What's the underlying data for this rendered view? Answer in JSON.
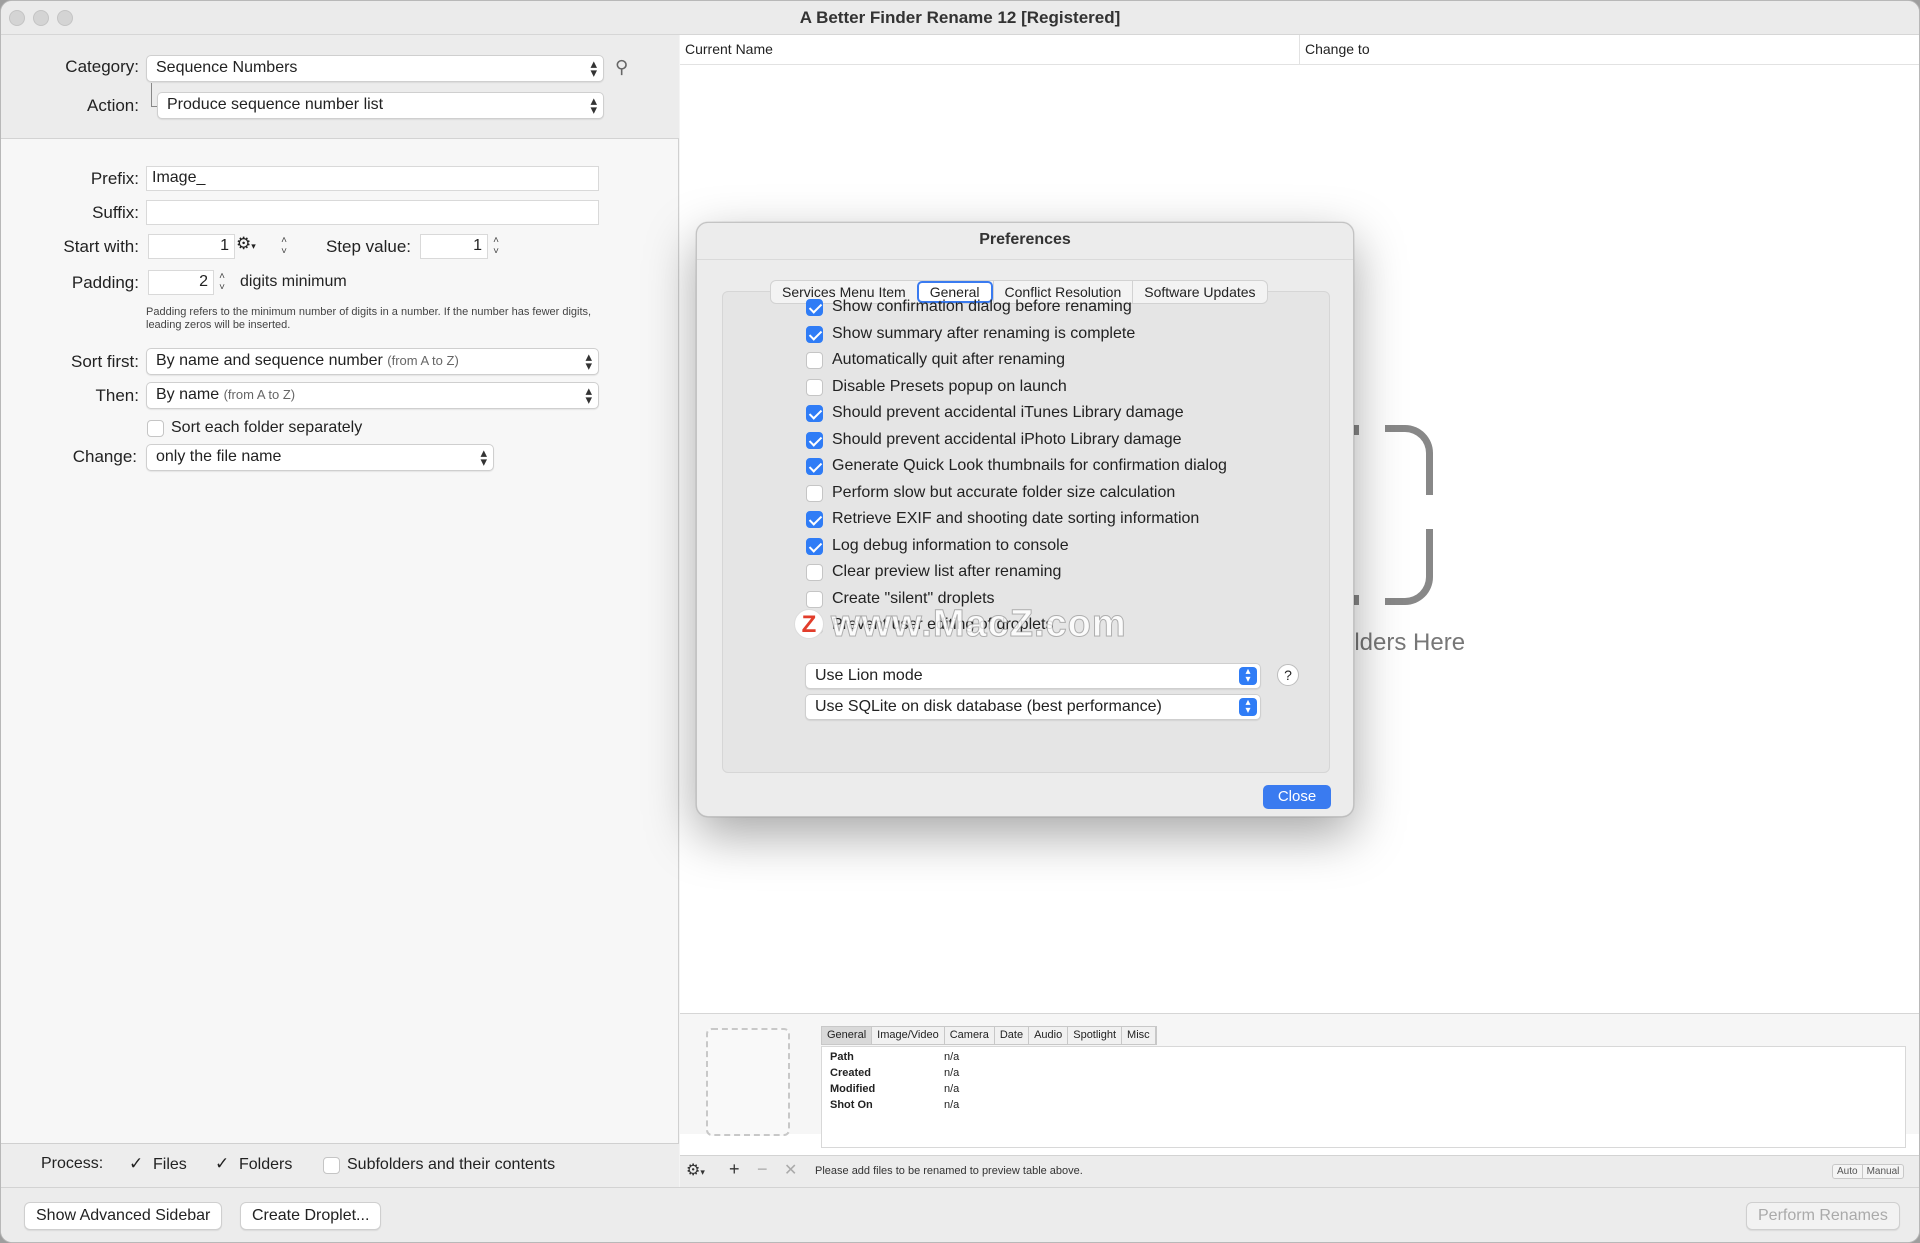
{
  "window": {
    "title": "A Better Finder Rename 12 [Registered]"
  },
  "sidebar": {
    "category_label": "Category:",
    "category_value": "Sequence Numbers",
    "action_label": "Action:",
    "action_value": "Produce sequence number list",
    "prefix_label": "Prefix:",
    "prefix_value": "Image_",
    "suffix_label": "Suffix:",
    "suffix_value": "",
    "start_with_label": "Start with:",
    "start_with_value": "1",
    "step_value_label": "Step value:",
    "step_value_value": "1",
    "padding_label": "Padding:",
    "padding_value": "2",
    "padding_suffix": "digits minimum",
    "padding_help": "Padding refers to the minimum number of digits in a number. If the number has fewer digits, leading zeros will be inserted.",
    "sort_first_label": "Sort first:",
    "sort_first_value": "By name and sequence number",
    "sort_first_sub": "(from A to Z)",
    "then_label": "Then:",
    "then_value": "By name",
    "then_sub": "(from A to Z)",
    "sort_each_folder_label": "Sort each folder separately",
    "sort_each_folder_checked": false,
    "change_label": "Change:",
    "change_value": "only the file name"
  },
  "process": {
    "label": "Process:",
    "files_label": "Files",
    "files_checked": true,
    "folders_label": "Folders",
    "folders_checked": true,
    "subfolders_label": "Subfolders and their contents",
    "subfolders_checked": false
  },
  "footer": {
    "show_advanced_label": "Show Advanced Sidebar",
    "create_droplet_label": "Create Droplet...",
    "perform_renames_label": "Perform Renames"
  },
  "preview": {
    "col_current": "Current Name",
    "col_change": "Change to",
    "drop_text": "olders Here"
  },
  "info": {
    "tabs": [
      "General",
      "Image/Video",
      "Camera",
      "Date",
      "Audio",
      "Spotlight",
      "Misc"
    ],
    "active_tab": "General",
    "rows": [
      {
        "key": "Path",
        "value": "n/a"
      },
      {
        "key": "Created",
        "value": "n/a"
      },
      {
        "key": "Modified",
        "value": "n/a"
      },
      {
        "key": "Shot On",
        "value": "n/a"
      }
    ]
  },
  "bottom_bar": {
    "status": "Please add files to be renamed to preview table above.",
    "mode_auto": "Auto",
    "mode_manual": "Manual"
  },
  "dialog": {
    "title": "Preferences",
    "tabs": [
      "Services Menu Item",
      "General",
      "Conflict Resolution",
      "Software Updates"
    ],
    "active_tab": "General",
    "options": [
      {
        "label": "Show confirmation dialog before renaming",
        "checked": true
      },
      {
        "label": "Show summary after renaming is complete",
        "checked": true
      },
      {
        "label": "Automatically quit after renaming",
        "checked": false
      },
      {
        "label": "Disable Presets popup on launch",
        "checked": false
      },
      {
        "label": "Should prevent accidental iTunes Library damage",
        "checked": true
      },
      {
        "label": "Should prevent accidental iPhoto Library damage",
        "checked": true
      },
      {
        "label": "Generate Quick Look thumbnails for confirmation dialog",
        "checked": true
      },
      {
        "label": "Perform slow but accurate folder size calculation",
        "checked": false
      },
      {
        "label": "Retrieve EXIF and shooting date sorting information",
        "checked": true
      },
      {
        "label": "Log debug information to console",
        "checked": true
      },
      {
        "label": "Clear preview list after renaming",
        "checked": false
      },
      {
        "label": "Create \"silent\" droplets",
        "checked": false
      },
      {
        "label": "Prevent user editing of droplets",
        "checked": false
      }
    ],
    "mode_select": "Use Lion mode",
    "db_select": "Use SQLite on disk database (best performance)",
    "help_label": "?",
    "close_label": "Close"
  },
  "watermark": {
    "text": "www.MacZ.com",
    "logo": "Z"
  }
}
